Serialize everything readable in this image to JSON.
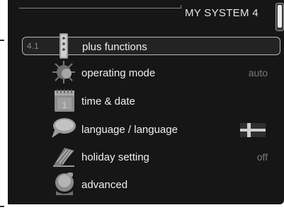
{
  "header": {
    "title": "MY SYSTEM 4"
  },
  "menu": [
    {
      "num": "4.1",
      "label": "plus functions",
      "value": "",
      "icon": "plus-functions-icon"
    },
    {
      "num": "",
      "label": "operating mode",
      "value": "auto",
      "icon": "sun-mode-icon"
    },
    {
      "num": "",
      "label": "time & date",
      "value": "",
      "icon": "calendar-icon"
    },
    {
      "num": "",
      "label": "language / language",
      "value": "",
      "icon": "speech-bubble-icon",
      "flag": "swedish-flag-icon"
    },
    {
      "num": "",
      "label": "holiday setting",
      "value": "off",
      "icon": "deck-chair-icon"
    },
    {
      "num": "",
      "label": "advanced",
      "value": "",
      "icon": "advanced-person-icon"
    }
  ],
  "colors": {
    "background": "#161616",
    "text": "#f0f0f0",
    "muted": "#7a7a7a",
    "flag_blue": "#2f2f2f",
    "flag_cross": "#cfcfcf"
  }
}
